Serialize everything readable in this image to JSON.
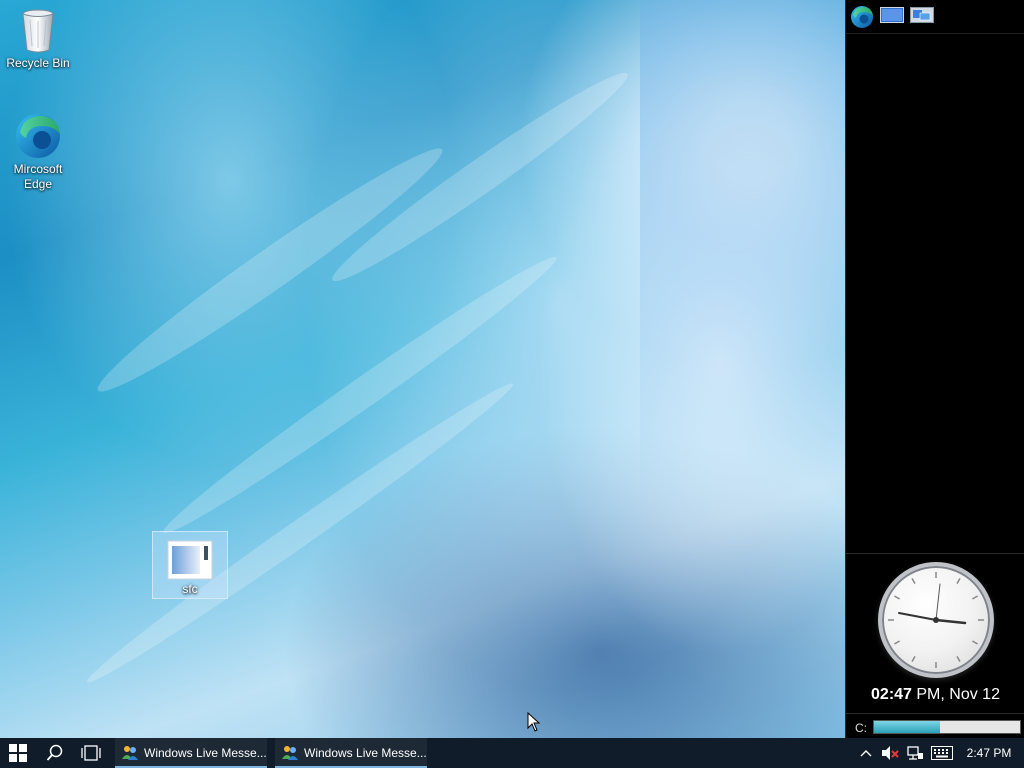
{
  "desktop": {
    "icons": [
      {
        "label": "Recycle Bin",
        "icon": "recycle-bin-icon"
      },
      {
        "label": "Mircosoft Edge",
        "icon": "edge-icon"
      },
      {
        "label": "sfc",
        "icon": "window-app-icon"
      }
    ]
  },
  "sidebar": {
    "top_icons": [
      "edge-icon",
      "show-desktop-icon",
      "switch-windows-icon"
    ],
    "clock": {
      "hour_min": "02:47",
      "rest": " PM, Nov 12"
    },
    "drive": {
      "label": "C:",
      "used_fraction": 0.45
    }
  },
  "taskbar": {
    "tasks": [
      {
        "label": "Windows Live Messe..."
      },
      {
        "label": "Windows Live Messe..."
      }
    ],
    "tray_time": "2:47 PM"
  },
  "colors": {
    "taskbar": "#101c2a",
    "sidebar": "#000000",
    "accent": "#7fb3e0"
  }
}
